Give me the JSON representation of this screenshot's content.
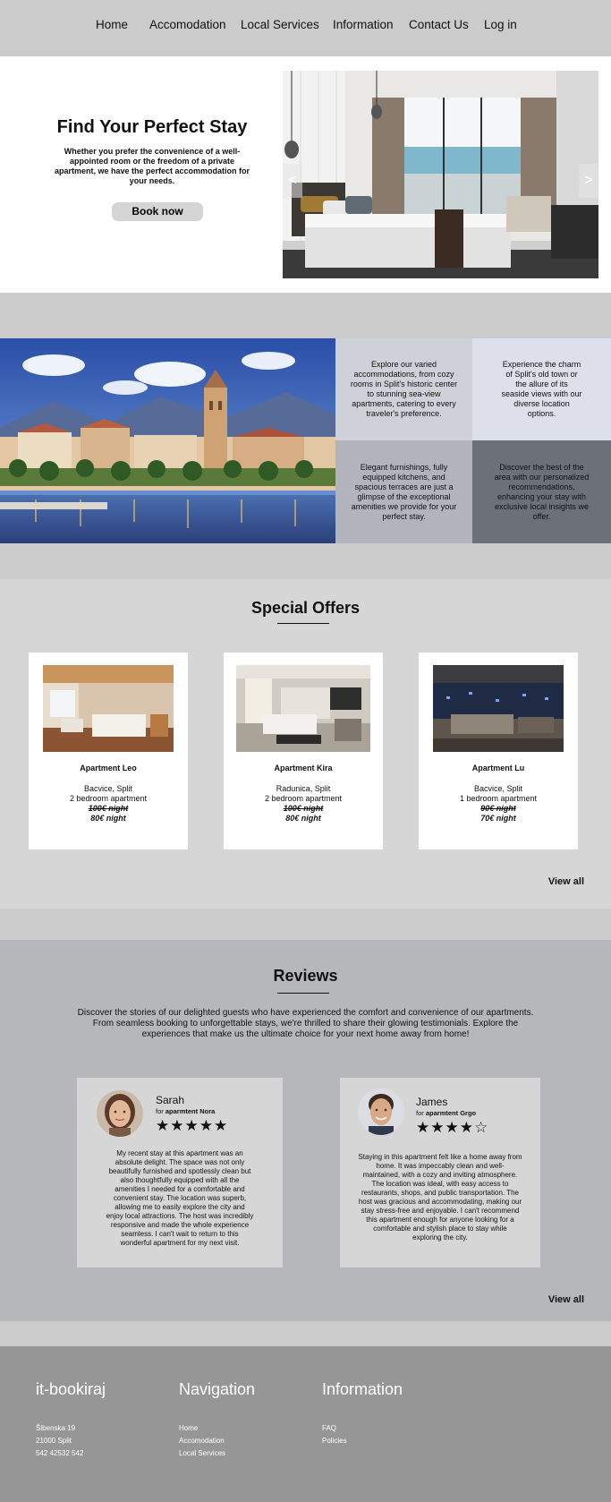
{
  "nav": {
    "items": [
      "Home",
      "Accomodation",
      "Local Services",
      "Information",
      "Contact Us",
      "Log in"
    ]
  },
  "hero": {
    "title": "Find Your Perfect Stay",
    "text": "Whether you prefer the convenience of a well-appointed room or the freedom of a private apartment, we have the perfect accommodation for your needs.",
    "button": "Book now",
    "prev_arrow": "<",
    "next_arrow": ">"
  },
  "features": [
    "Explore our varied accommodations, from cozy rooms in Split's historic center to stunning sea-view apartments, catering to every traveler's preference.",
    "Experience the charm of Split's old town or the allure of its seaside views with our diverse location options.",
    "Elegant furnishings, fully equipped kitchens, and spacious terraces are just a glimpse of the exceptional amenities we provide for your perfect stay.",
    "Discover the best of the area with our personalized recommendations, enhancing your stay with exclusive local insights we offer."
  ],
  "offers": {
    "title": "Special Offers",
    "cards": [
      {
        "name": "Apartment Leo",
        "location": "Bacvice, Split",
        "type": "2 bedroom apartment",
        "old_price": "100€ night",
        "price": "80€ night"
      },
      {
        "name": "Apartment Kira",
        "location": "Radunica, Split",
        "type": "2 bedroom apartment",
        "old_price": "100€ night",
        "price": "80€ night"
      },
      {
        "name": "Apartment Lu",
        "location": "Bacvice, Split",
        "type": "1 bedroom apartment",
        "old_price": "90€ night",
        "price": "70€ night"
      }
    ],
    "view_all": "View all"
  },
  "reviews": {
    "title": "Reviews",
    "intro": "Discover the stories of our delighted guests who have experienced the comfort and convenience of our apartments. From seamless booking to unforgettable stays, we're thrilled to share their glowing testimonials. Explore the experiences that make us the ultimate choice for your next home away from home!",
    "items": [
      {
        "name": "Sarah",
        "for_prefix": "for",
        "apartment": "aparmtent Nora",
        "stars": "★★★★★",
        "text": "My recent stay at this apartment was an absolute delight. The space was not only beautifully furnished and spotlessly clean but also thoughtfully equipped with all the amenities I needed for a comfortable and convenient stay. The location was superb, allowing me to easily explore the city and enjoy local attractions. The host was incredibly responsive and made the whole experience seamless. I can't wait to return to this wonderful apartment for my next visit."
      },
      {
        "name": "James",
        "for_prefix": "for",
        "apartment": "aparmtent Grgo",
        "stars": "★★★★☆",
        "text": "Staying in this apartment felt like a home away from home. It was impeccably clean and well-maintained, with a cozy and inviting atmosphere. The location was ideal, with easy access to restaurants, shops, and public transportation. The host was gracious and accommodating, making our stay stress-free and enjoyable. I can't recommend this apartment enough for anyone looking for a comfortable and stylish place to stay while exploring the city."
      }
    ],
    "view_all": "View all"
  },
  "footer": {
    "brand": "it-bookiraj",
    "address": [
      "Šibenska 19",
      "21000 Split",
      "542 42532 542"
    ],
    "nav_title": "Navigation",
    "nav_links": [
      "Home",
      "Accomodation",
      "Local Services"
    ],
    "info_title": "Information",
    "info_links": [
      "FAQ",
      "Policies"
    ]
  }
}
